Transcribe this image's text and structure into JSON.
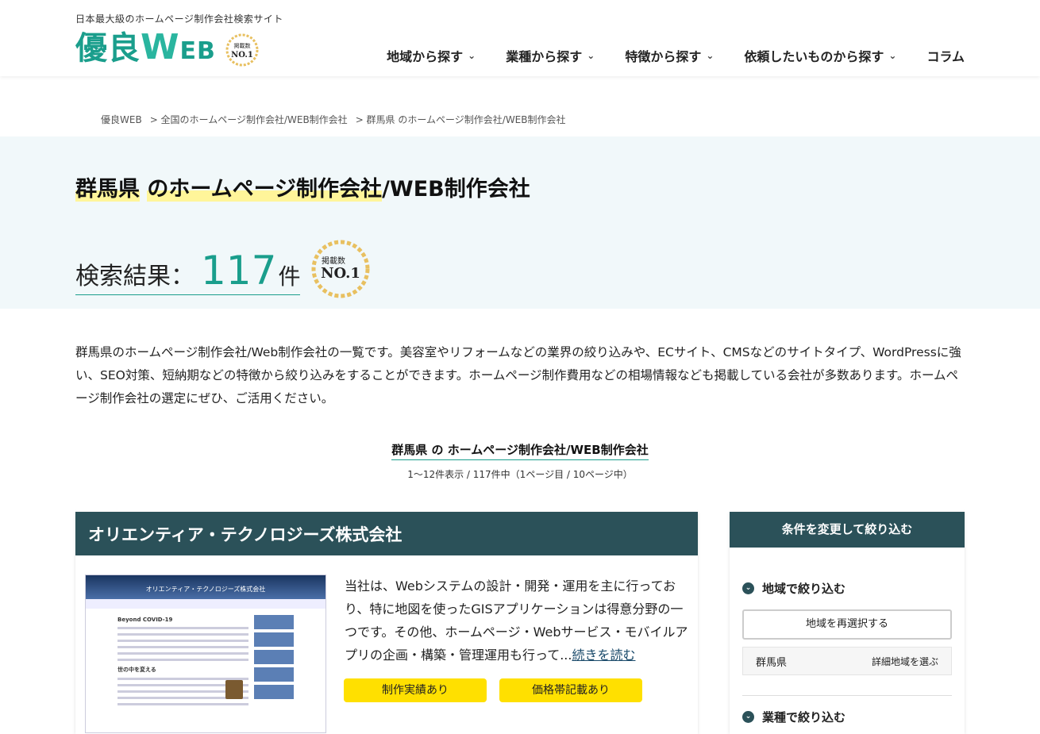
{
  "header": {
    "tagline": "日本最大級のホームページ制作会社検索サイト",
    "logo": "優良WEB",
    "badge_top": "掲載数",
    "badge_bottom": "NO.1",
    "nav": [
      {
        "label": "地域から探す"
      },
      {
        "label": "業種から探す"
      },
      {
        "label": "特徴から探す"
      },
      {
        "label": "依頼したいものから探す"
      },
      {
        "label": "コラム"
      }
    ]
  },
  "breadcrumb": [
    "優良WEB",
    "> 全国のホームページ制作会社/WEB制作会社",
    "> 群馬県 のホームページ制作会社/WEB制作会社"
  ],
  "hero": {
    "title_part1": "群馬県",
    "title_part2": "のホームページ制作会社",
    "title_part3": "/WEB制作会社",
    "count_label": "検索結果：",
    "count_value": "117",
    "count_unit": "件"
  },
  "intro": "群馬県のホームページ制作会社/Web制作会社の一覧です。美容室やリフォームなどの業界の絞り込みや、ECサイト、CMSなどのサイトタイプ、WordPressに強い、SEO対策、短納期などの特徴から絞り込みをすることができます。ホームページ制作費用などの相場情報なども掲載している会社が多数あります。ホームページ制作会社の選定にぜひ、ご活用ください。",
  "list": {
    "title": "群馬県 の ホームページ制作会社/WEB制作会社",
    "subtitle": "1〜12件表示 / 117件中（1ページ目 / 10ページ中）"
  },
  "company": {
    "name": "オリエンティア・テクノロジーズ株式会社",
    "shot_title": "オリエンティア・テクノロジーズ株式会社",
    "shot_heading1": "Beyond COVID-19",
    "shot_heading2": "世の中を変える",
    "description": "当社は、Webシステムの設計・開発・運用を主に行っており、特に地図を使ったGISアプリケーションは得意分野の一つです。その他、ホームページ・Webサービス・モバイルアプリの企画・構築・管理運用も行って...",
    "read_more": "続きを読む",
    "tags": [
      "制作実績あり",
      "価格帯記載あり"
    ]
  },
  "sidebar": {
    "head": "条件を変更して絞り込む",
    "region_label": "地域で絞り込む",
    "reselect": "地域を再選択する",
    "prefecture": "群馬県",
    "detail": "詳細地域を選ぶ",
    "industry_label": "業種で絞り込む"
  }
}
